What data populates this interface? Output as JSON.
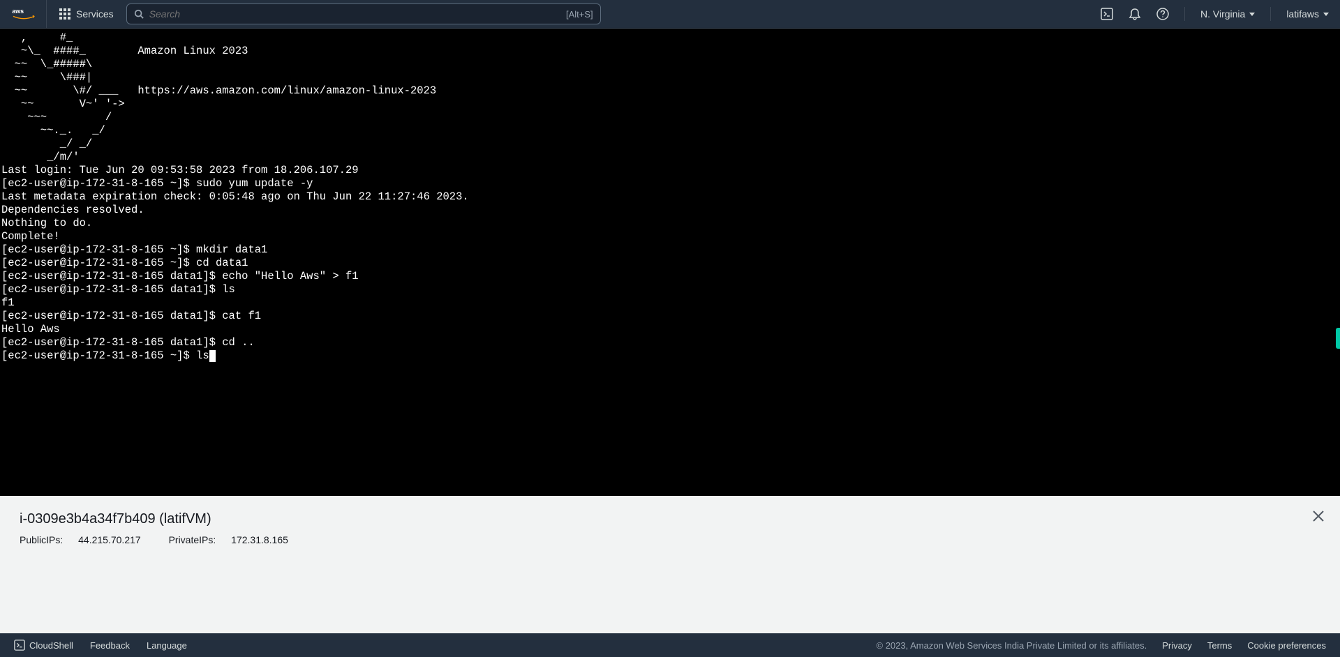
{
  "topnav": {
    "services_label": "Services",
    "search_placeholder": "Search",
    "search_shortcut": "[Alt+S]",
    "region": "N. Virginia",
    "account": "latifaws"
  },
  "terminal": {
    "content": "   ,     #_\n   ~\\_  ####_        Amazon Linux 2023\n  ~~  \\_#####\\\n  ~~     \\###|\n  ~~       \\#/ ___   https://aws.amazon.com/linux/amazon-linux-2023\n   ~~       V~' '->\n    ~~~         /\n      ~~._.   _/\n         _/ _/\n       _/m/'\nLast login: Tue Jun 20 09:53:58 2023 from 18.206.107.29\n[ec2-user@ip-172-31-8-165 ~]$ sudo yum update -y\nLast metadata expiration check: 0:05:48 ago on Thu Jun 22 11:27:46 2023.\nDependencies resolved.\nNothing to do.\nComplete!\n[ec2-user@ip-172-31-8-165 ~]$ mkdir data1\n[ec2-user@ip-172-31-8-165 ~]$ cd data1\n[ec2-user@ip-172-31-8-165 data1]$ echo \"Hello Aws\" > f1\n[ec2-user@ip-172-31-8-165 data1]$ ls\nf1\n[ec2-user@ip-172-31-8-165 data1]$ cat f1\nHello Aws\n[ec2-user@ip-172-31-8-165 data1]$ cd ..\n[ec2-user@ip-172-31-8-165 ~]$ ls"
  },
  "info": {
    "title": "i-0309e3b4a34f7b409 (latifVM)",
    "public_label": "PublicIPs:",
    "public_value": "44.215.70.217",
    "private_label": "PrivateIPs:",
    "private_value": "172.31.8.165"
  },
  "footer": {
    "cloudshell": "CloudShell",
    "feedback": "Feedback",
    "language": "Language",
    "copyright": "© 2023, Amazon Web Services India Private Limited or its affiliates.",
    "privacy": "Privacy",
    "terms": "Terms",
    "cookies": "Cookie preferences"
  }
}
